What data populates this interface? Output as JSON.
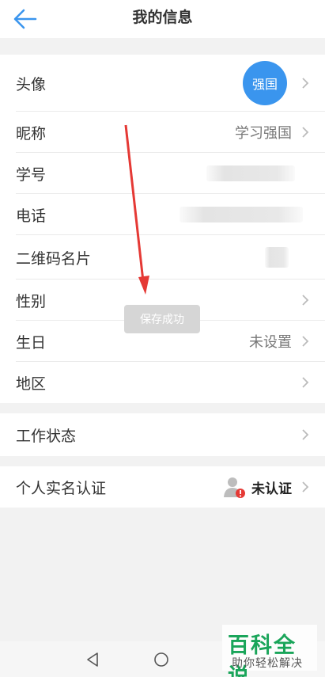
{
  "header": {
    "title": "我的信息"
  },
  "profile": {
    "avatar": {
      "label": "头像",
      "avatar_text": "强国"
    },
    "nickname": {
      "label": "昵称",
      "value": "学习强国"
    },
    "student_id": {
      "label": "学号"
    },
    "phone": {
      "label": "电话"
    },
    "qr_card": {
      "label": "二维码名片"
    },
    "gender": {
      "label": "性别"
    },
    "birthday": {
      "label": "生日",
      "value": "未设置"
    },
    "region": {
      "label": "地区"
    }
  },
  "work_status": {
    "label": "工作状态"
  },
  "verification": {
    "label": "个人实名认证",
    "status": "未认证"
  },
  "toast": {
    "text": "保存成功"
  },
  "watermark": {
    "main": "百科全说",
    "sub": "助你轻松解决"
  },
  "colors": {
    "accent": "#3a95ee",
    "annotation": "#e53935",
    "brand": "#1aa55a"
  }
}
